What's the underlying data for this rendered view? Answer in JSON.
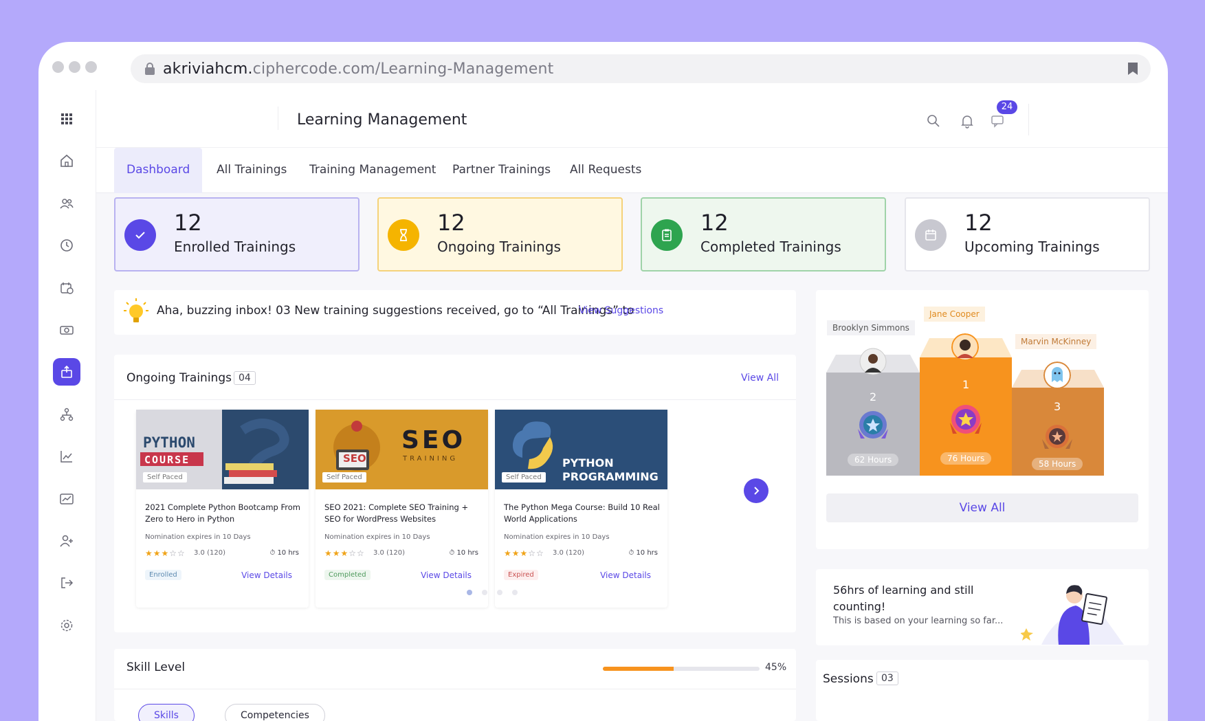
{
  "browser": {
    "url_domain": "akriviahcm.",
    "url_rest": "ciphercode.com/Learning-Management"
  },
  "header": {
    "title": "Learning Management",
    "notification_count": "24"
  },
  "tabs": [
    {
      "label": "Dashboard",
      "active": true
    },
    {
      "label": "All Trainings"
    },
    {
      "label": "Training Management"
    },
    {
      "label": "Partner Trainings"
    },
    {
      "label": "All Requests"
    }
  ],
  "stats": [
    {
      "value": "12",
      "label": "Enrolled Trainings",
      "icon": "check-icon",
      "color": "#5a48e6"
    },
    {
      "value": "12",
      "label": "Ongoing Trainings",
      "icon": "hourglass-icon",
      "color": "#f5b400"
    },
    {
      "value": "12",
      "label": "Completed Trainings",
      "icon": "clipboard-icon",
      "color": "#2ea44f"
    },
    {
      "value": "12",
      "label": "Upcoming Trainings",
      "icon": "calendar-icon",
      "color": "#c8c8d0"
    }
  ],
  "banner": {
    "text": "Aha, buzzing inbox! 03 New training suggestions received, go to “All Trainings” to",
    "link": "View Suggestions"
  },
  "ongoing": {
    "title": "Ongoing Trainings",
    "count": "04",
    "view_all": "View All",
    "courses": [
      {
        "thumb_line1": "PYTHON",
        "thumb_line2": "COURSE",
        "pace": "Self Paced",
        "title": "2021 Complete Python Bootcamp From Zero to Hero in Python",
        "expires": "Nomination expires in 10 Days",
        "stars": "★★★",
        "empty_stars": "☆☆",
        "rating": "3.0 (120)",
        "hours": "10 hrs",
        "status": "Enrolled",
        "action": "View Details"
      },
      {
        "thumb_line1": "SEO",
        "thumb_line2": "TRAINING",
        "thumb_tag": "SEO",
        "pace": "Self Paced",
        "title": "SEO 2021: Complete SEO Training + SEO for WordPress Websites",
        "expires": "Nomination expires in 10 Days",
        "stars": "★★★",
        "empty_stars": "☆☆",
        "rating": "3.0 (120)",
        "hours": "10 hrs",
        "status": "Completed",
        "action": "View Details"
      },
      {
        "thumb_line1": "PYTHON",
        "thumb_line2": "PROGRAMMING",
        "pace": "Self Paced",
        "title": "The Python Mega Course: Build 10 Real World Applications",
        "expires": "Nomination expires in 10 Days",
        "stars": "★★★",
        "empty_stars": "☆☆",
        "rating": "3.0 (120)",
        "hours": "10 hrs",
        "status": "Expired",
        "action": "View Details"
      }
    ]
  },
  "skill": {
    "title": "Skill Level",
    "progress": 0.45,
    "percent_label": "45%",
    "tabs": [
      "Skills",
      "Competencies"
    ]
  },
  "leaderboard": {
    "entries": [
      {
        "rank": "1",
        "name": "Jane Cooper",
        "hours": "76 Hours"
      },
      {
        "rank": "2",
        "name": "Brooklyn Simmons",
        "hours": "62 Hours"
      },
      {
        "rank": "3",
        "name": "Marvin McKinney",
        "hours": "58 Hours"
      }
    ],
    "view_all": "View All"
  },
  "learning": {
    "title": "56hrs of learning and still counting!",
    "subtitle": "This is based on your learning so far..."
  },
  "sessions": {
    "title": "Sessions",
    "count": "03"
  },
  "colors": {
    "accent": "#5a48e6",
    "orange": "#f7931e",
    "background": "#b4a9fb"
  }
}
